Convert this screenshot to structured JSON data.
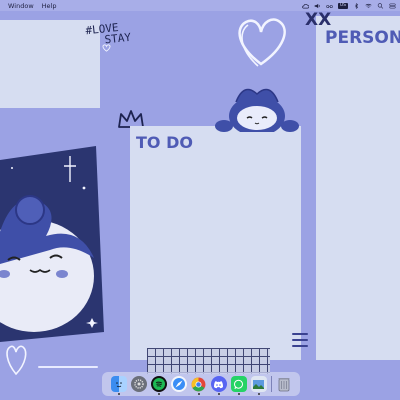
{
  "menubar": {
    "items": [
      "Window",
      "Help"
    ],
    "tray_badge": "US"
  },
  "notes": {
    "todo_title": "TO DO",
    "personal_title": "PERSONA"
  },
  "stickers": {
    "love_line1": "#LOVE",
    "love_line2": "STAY",
    "xx": "XX"
  },
  "dock": {
    "apps": [
      {
        "icon": "finder-icon",
        "color": "#3b8df0"
      },
      {
        "icon": "settings-icon",
        "color": "#6b6f7a"
      },
      {
        "icon": "spotify-icon",
        "color": "#1db954"
      },
      {
        "icon": "safari-icon",
        "color": "#3a8ef6"
      },
      {
        "icon": "chrome-icon",
        "color": "#e3473a"
      },
      {
        "icon": "discord-icon",
        "color": "#5865f2"
      },
      {
        "icon": "whatsapp-icon",
        "color": "#25d366"
      },
      {
        "icon": "preview-icon",
        "color": "#5d9adf"
      },
      {
        "icon": "trash-icon",
        "color": "#8f93a8"
      }
    ]
  },
  "colors": {
    "desktop": "#9ba2e4",
    "note": "#d6ddf1",
    "accent": "#4f5bb5"
  }
}
